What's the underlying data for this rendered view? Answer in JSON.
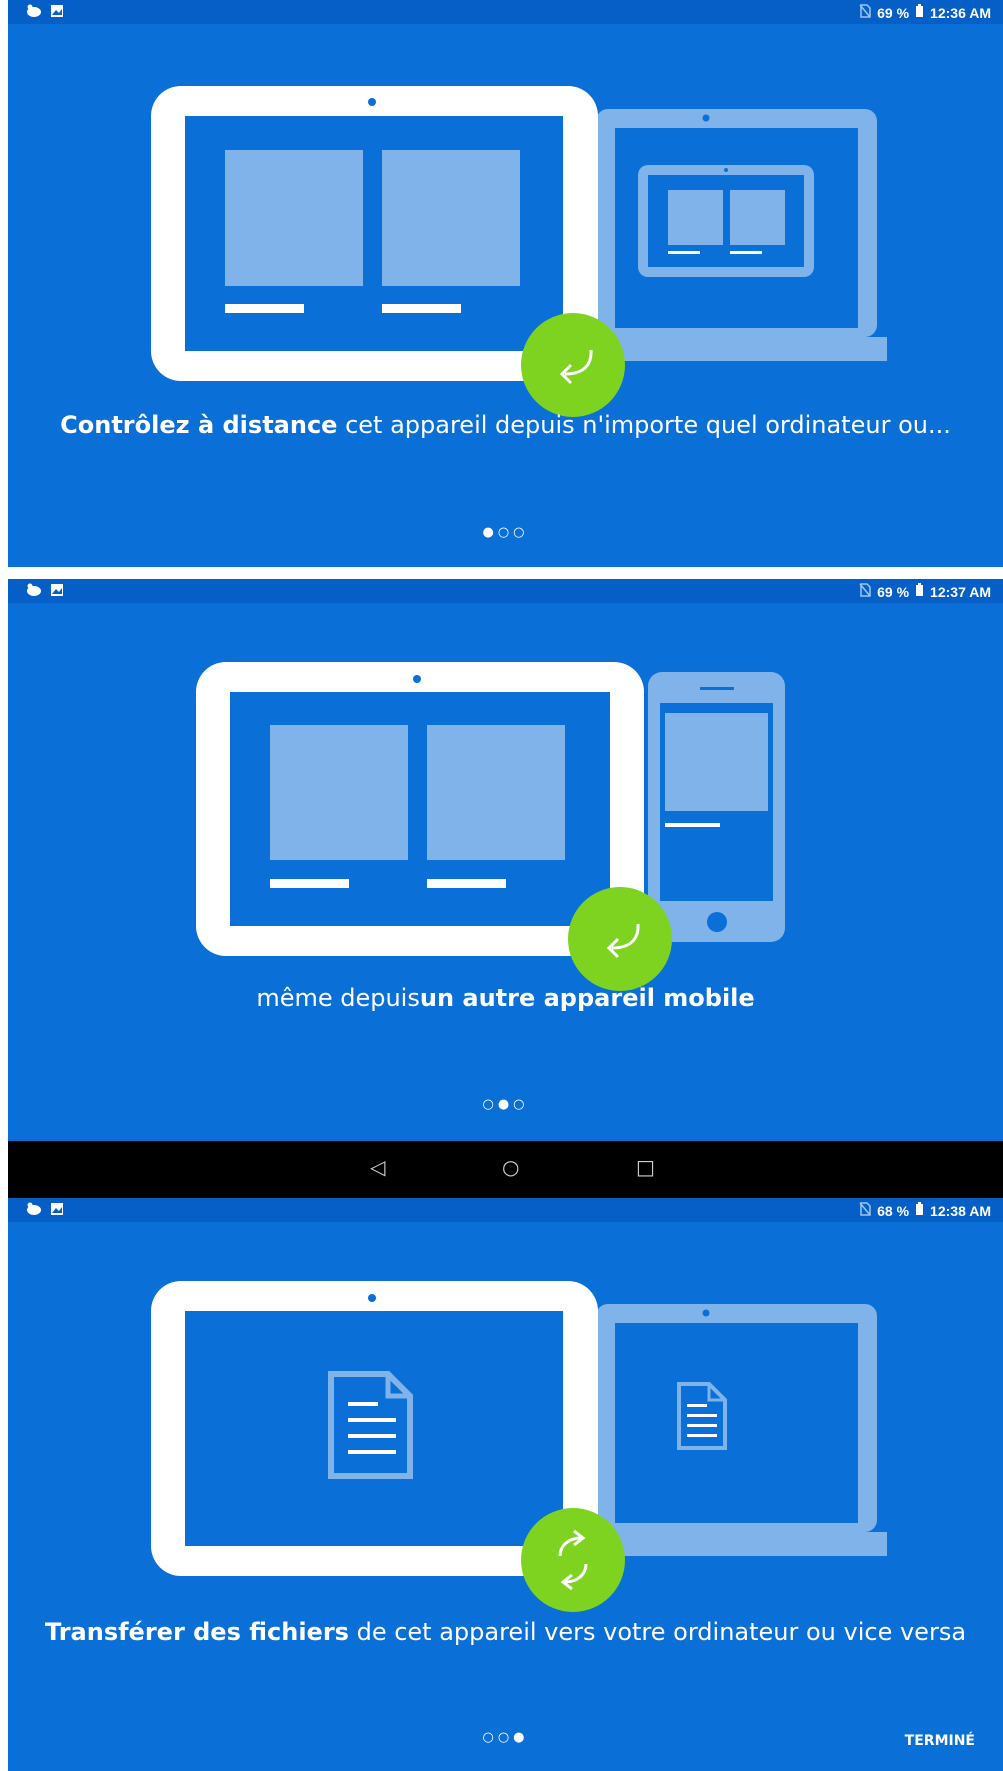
{
  "screens": [
    {
      "status": {
        "left_icons": [
          "notification-icon",
          "image-icon"
        ],
        "battery": "69 %",
        "time": "12:36 AM"
      },
      "caption_bold": "Contrôlez à distance",
      "caption_rest": " cet appareil depuis n'importe quel ordinateur ou...",
      "dots": "●○○"
    },
    {
      "status": {
        "left_icons": [
          "notification-icon",
          "image-icon"
        ],
        "battery": "69 %",
        "time": "12:37 AM"
      },
      "caption_pre": "même depuis",
      "caption_bold": "un autre appareil mobile",
      "dots": "○●○"
    },
    {
      "status": {
        "left_icons": [
          "notification-icon",
          "image-icon"
        ],
        "battery": "68 %",
        "time": "12:38 AM"
      },
      "caption_bold": "Transférer des fichiers",
      "caption_rest": " de cet appareil vers votre ordinateur ou vice versa",
      "dots": "○○●",
      "done_label": "TERMINÉ"
    }
  ],
  "navbar": {
    "back": "◁",
    "home": "○",
    "recents": "□"
  },
  "colors": {
    "background": "#0a6fd6",
    "statusbar": "#055fc6",
    "accent_green": "#7ed321",
    "light_blue": "#7fb3ea"
  }
}
